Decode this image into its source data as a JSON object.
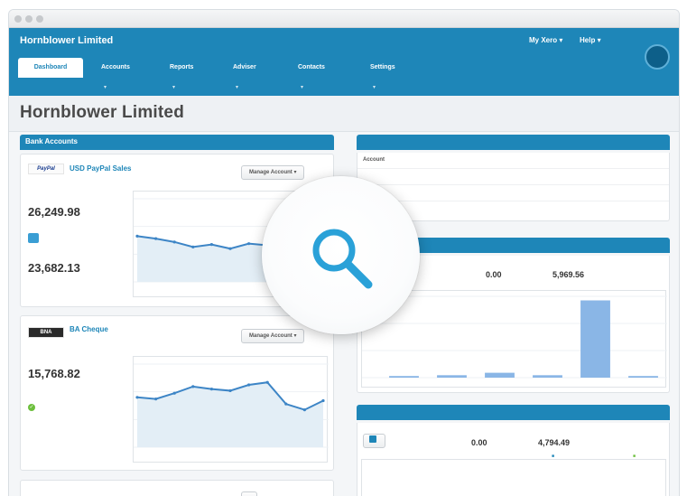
{
  "window": {
    "title": ""
  },
  "header": {
    "org_name": "Hornblower Limited",
    "user_link": "",
    "logout_link": "",
    "my_xero": "My Xero",
    "help": "Help",
    "avatar_text": ""
  },
  "tabs": [
    {
      "label": "Dashboard"
    },
    {
      "label": "Accounts"
    },
    {
      "label": "Reports"
    },
    {
      "label": "Adviser"
    },
    {
      "label": "Contacts"
    },
    {
      "label": "Settings"
    }
  ],
  "page": {
    "title": "Hornblower Limited"
  },
  "bank_accounts": {
    "title": "Bank Accounts",
    "link": "",
    "accounts": [
      {
        "logo": "PayPal",
        "name": "USD PayPal Sales",
        "sub": "",
        "manage_label": "Manage Account",
        "statement_label": "",
        "statement_balance": "26,249.98",
        "statement_date": "",
        "reconcile_label": "",
        "xero_label": "",
        "xero_balance": "23,682.13",
        "chart_y_labels": [
          "",
          "",
          "",
          ""
        ],
        "chart_x_labels": [
          "",
          "",
          ""
        ],
        "chart_values": [
          0.55,
          0.52,
          0.48,
          0.42,
          0.45,
          0.4,
          0.46,
          0.44,
          0.55,
          0.82,
          0.9
        ]
      },
      {
        "logo": "BNA",
        "name": "BA Cheque",
        "sub": "",
        "manage_label": "Manage Account",
        "statement_label": "",
        "statement_balance": "15,768.82",
        "statement_date": "",
        "reconciled_label": "",
        "chart_y_labels": [
          "",
          "",
          "",
          ""
        ],
        "chart_x_labels": [
          "",
          "",
          "",
          ""
        ],
        "chart_values": [
          0.6,
          0.58,
          0.65,
          0.73,
          0.7,
          0.68,
          0.75,
          0.78,
          0.52,
          0.45,
          0.56
        ]
      },
      {
        "name": "",
        "manage_label": ""
      }
    ]
  },
  "watchlist": {
    "title": "",
    "link": "",
    "columns": [
      "Account",
      "",
      ""
    ],
    "rows": [
      {
        "account": "",
        "col2": "",
        "col3": ""
      },
      {
        "account": "",
        "col2": "",
        "col3": ""
      },
      {
        "account": "",
        "col2": "",
        "col3": ""
      }
    ]
  },
  "money_in": {
    "title": "",
    "link": "",
    "invoice_btn": "",
    "draft_label": "",
    "draft_value": "0.00",
    "overdue_label": "",
    "overdue_value": "5,969.56",
    "y_labels": [
      "",
      ""
    ],
    "x_labels": [
      "",
      "",
      "",
      "",
      "",
      ""
    ],
    "bar_values": [
      0.02,
      0.03,
      0.06,
      0.03,
      0.95,
      0.02
    ]
  },
  "money_out": {
    "title": "",
    "link": "",
    "invoice_btn": "",
    "draft_label": "",
    "draft_value": "0.00",
    "overdue_label": "",
    "overdue_value": "4,794.49",
    "legend": [
      "",
      ""
    ],
    "y_labels": [
      "",
      ""
    ]
  },
  "colors": {
    "brand": "#1e86b8",
    "page_bg": "#f4f6f8",
    "success": "#55a630"
  }
}
